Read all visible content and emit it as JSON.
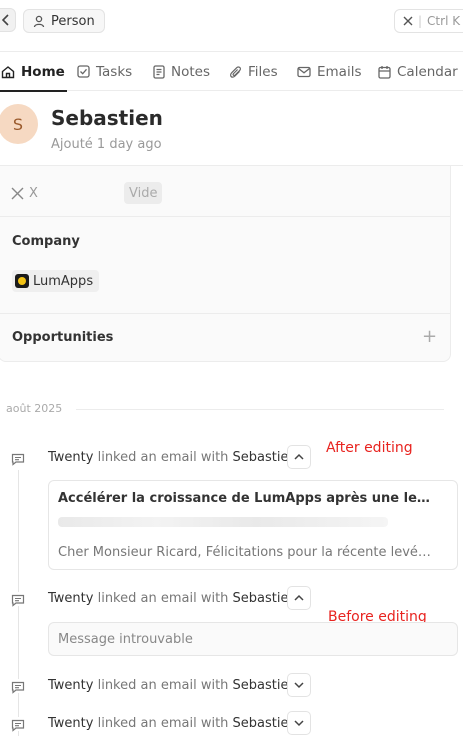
{
  "topbar": {
    "breadcrumb_label": "Person",
    "search_shortcut": "Ctrl K"
  },
  "tabs": [
    {
      "label": "Home",
      "icon": "home-icon",
      "active": true
    },
    {
      "label": "Tasks",
      "icon": "checkbox-icon",
      "active": false
    },
    {
      "label": "Notes",
      "icon": "notes-icon",
      "active": false
    },
    {
      "label": "Files",
      "icon": "paperclip-icon",
      "active": false
    },
    {
      "label": "Emails",
      "icon": "mail-icon",
      "active": false
    },
    {
      "label": "Calendar",
      "icon": "calendar-icon",
      "active": false
    }
  ],
  "record": {
    "avatar_initial": "S",
    "name": "Sebastien",
    "subtitle": "Ajouté 1 day ago"
  },
  "fields": {
    "x_label": "X",
    "x_value": "Vide",
    "company_heading": "Company",
    "company_name": "LumApps",
    "opportunities_heading": "Opportunities"
  },
  "timeline": {
    "month_label": "août 2025",
    "events": [
      {
        "actor": "Twenty",
        "action": "linked an email with",
        "target": "Sebastien",
        "expanded": true
      },
      {
        "actor": "Twenty",
        "action": "linked an email with",
        "target": "Sebastien",
        "expanded": true
      },
      {
        "actor": "Twenty",
        "action": "linked an email with",
        "target": "Sebastien",
        "expanded": false
      },
      {
        "actor": "Twenty",
        "action": "linked an email with",
        "target": "Sebastien",
        "expanded": false
      }
    ],
    "email_subject": "Accélérer la croissance de LumApps après une levée de fo...",
    "email_preview": "Cher Monsieur Ricard, Félicitations pour la récente levée de...",
    "missing_message": "Message introuvable"
  },
  "annotations": {
    "after": "After editing",
    "before": "Before editing"
  },
  "colors": {
    "annotation": "#e8231f",
    "avatar_bg": "#f6d9c2",
    "avatar_fg": "#9a5a2c"
  }
}
